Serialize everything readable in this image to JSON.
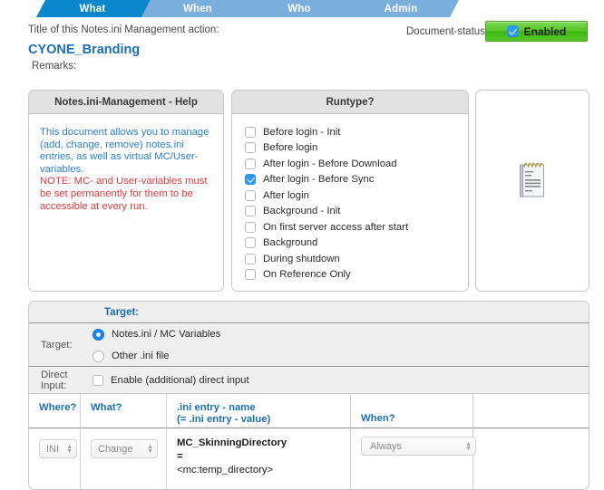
{
  "tabs": [
    {
      "label": "What",
      "active": true
    },
    {
      "label": "When",
      "active": false
    },
    {
      "label": "Who",
      "active": false
    },
    {
      "label": "Admin",
      "active": false
    }
  ],
  "header": {
    "title_label": "Title of this Notes.ini Management action:",
    "doc_title": "CYONE_Branding",
    "remarks_label": "Remarks:",
    "doc_status_label": "Document-status:",
    "status_value": "Enabled"
  },
  "help_panel": {
    "heading": "Notes.ini-Management - Help",
    "paragraph_blue": "This document allows you to manage (add, change, remove) notes.ini entries, as well as virtual MC/User-variables.",
    "paragraph_red": "NOTE: MC- and User-variables must be set permanently for them to be accessible at every run."
  },
  "runtype_panel": {
    "heading": "Runtype?",
    "options": [
      {
        "label": "Before login - Init",
        "checked": false
      },
      {
        "label": "Before login",
        "checked": false
      },
      {
        "label": "After login - Before Download",
        "checked": false
      },
      {
        "label": "After login - Before Sync",
        "checked": true
      },
      {
        "label": "After login",
        "checked": false
      },
      {
        "label": "Background - Init",
        "checked": false
      },
      {
        "label": "On first server access after start",
        "checked": false
      },
      {
        "label": "Background",
        "checked": false
      },
      {
        "label": "During shutdown",
        "checked": false
      },
      {
        "label": "On Reference Only",
        "checked": false
      }
    ]
  },
  "icon_panel": {
    "icon": "notepad-icon"
  },
  "target_section": {
    "section_title": "Target:",
    "target_row_label": "Target:",
    "target_options": [
      {
        "label": "Notes.ini / MC Variables",
        "selected": true
      },
      {
        "label": "Other .ini file",
        "selected": false
      }
    ],
    "direct_input_label": "Direct Input:",
    "direct_input_checkbox": {
      "label": "Enable (additional) direct input",
      "checked": false
    }
  },
  "table": {
    "headers": {
      "where": "Where?",
      "what": "What?",
      "entry_line1": ".ini entry - name",
      "entry_line2": "(= .ini entry - value)",
      "when": "When?"
    },
    "rows": [
      {
        "where": "INI",
        "what": "Change",
        "entry_name": "MC_SkinningDirectory",
        "entry_equals": "=",
        "entry_value": "<mc:temp_directory>",
        "when": "Always"
      }
    ]
  },
  "colors": {
    "tab_active": "#0b87ce",
    "tab_inactive": "#79aedd",
    "accent_blue": "#1c6fb5",
    "help_blue": "#2a7fd4",
    "help_red": "#e23a3a",
    "status_green": "#55c526",
    "checkbox_blue": "#2e9bf0"
  }
}
